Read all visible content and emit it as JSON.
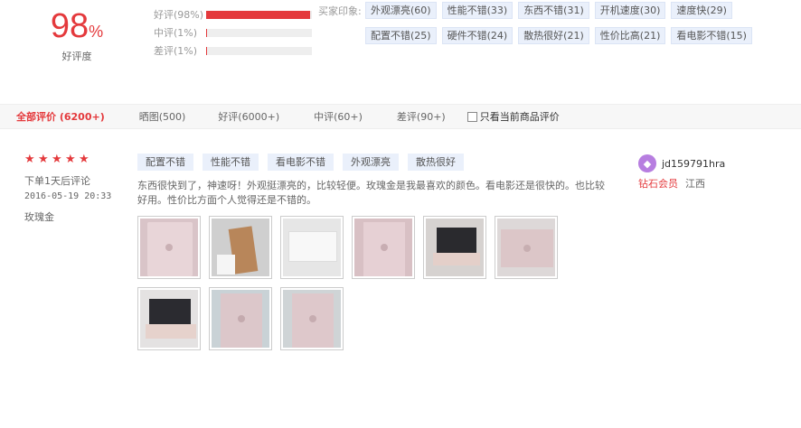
{
  "summary": {
    "rate": "98",
    "rate_unit": "%",
    "rate_label": "好评度"
  },
  "distribution": [
    {
      "label": "好评(98%)",
      "fraction": 0.98
    },
    {
      "label": "中评(1%)",
      "fraction": 0.01
    },
    {
      "label": "差评(1%)",
      "fraction": 0.01
    }
  ],
  "impressions": {
    "label": "买家印象:",
    "tags": [
      "外观漂亮(60)",
      "性能不错(33)",
      "东西不错(31)",
      "开机速度(30)",
      "速度快(29)",
      "配置不错(25)",
      "硬件不错(24)",
      "散热很好(21)",
      "性价比高(21)",
      "看电影不错(15)"
    ]
  },
  "filter": {
    "tabs": [
      "全部评价 (6200+)",
      "晒图(500)",
      "好评(6000+)",
      "中评(60+)",
      "差评(90+)"
    ],
    "active": 0,
    "only_current": "只看当前商品评价"
  },
  "review": {
    "stars": 5,
    "buy_note": "下单1天后评论",
    "date": "2016-05-19 20:33",
    "variant": "玫瑰金",
    "tags": [
      "配置不错",
      "性能不错",
      "看电影不错",
      "外观漂亮",
      "散热很好"
    ],
    "text": "东西很快到了，神速呀！外观挺漂亮的，比较轻便。玫瑰金是我最喜欢的颜色。看电影还是很快的。也比较好用。性价比方面个人觉得还是不错的。",
    "images": [
      "photo-1",
      "photo-2",
      "photo-3",
      "photo-4",
      "photo-5",
      "photo-6",
      "photo-7",
      "photo-8",
      "photo-9"
    ]
  },
  "user": {
    "name": "jd159791hra",
    "level": "钻石会员",
    "region": "江西"
  },
  "colors": {
    "accent": "#e4393c",
    "tag_bg": "#eaf0fb",
    "avatar": "#b77ee0"
  }
}
